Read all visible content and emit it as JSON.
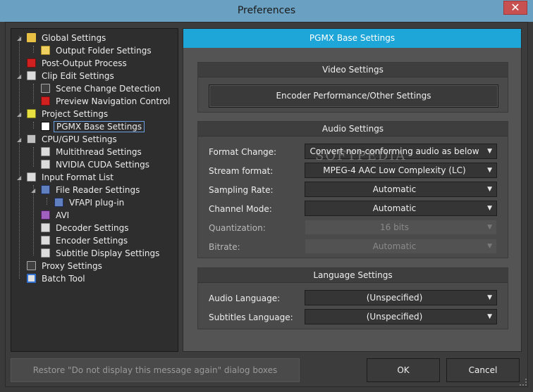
{
  "window": {
    "title": "Preferences",
    "close_glyph": "✕"
  },
  "tree": [
    {
      "label": "Global Settings",
      "icon": "folder-icon"
    },
    {
      "label": "Output Folder Settings",
      "icon": "folder-settings-icon"
    },
    {
      "label": "Post-Output Process",
      "icon": "process-icon"
    },
    {
      "label": "Clip Edit Settings",
      "icon": "document-icon"
    },
    {
      "label": "Scene Change Detection",
      "icon": "film-icon"
    },
    {
      "label": "Preview Navigation Control",
      "icon": "navigation-icon"
    },
    {
      "label": "Project Settings",
      "icon": "project-icon"
    },
    {
      "label": "PGMX Base Settings",
      "icon": "pgmx-icon"
    },
    {
      "label": "CPU/GPU Settings",
      "icon": "cpu-icon"
    },
    {
      "label": "Multithread Settings",
      "icon": "document-icon"
    },
    {
      "label": "NVIDIA CUDA Settings",
      "icon": "document-icon"
    },
    {
      "label": "Input Format List",
      "icon": "document-icon"
    },
    {
      "label": "File Reader Settings",
      "icon": "monitor-icon"
    },
    {
      "label": "VFAPI plug-in",
      "icon": "monitor-icon"
    },
    {
      "label": "AVI",
      "icon": "avi-icon"
    },
    {
      "label": "Decoder Settings",
      "icon": "document-icon"
    },
    {
      "label": "Encoder Settings",
      "icon": "document-icon"
    },
    {
      "label": "Subtitle Display Settings",
      "icon": "document-icon"
    },
    {
      "label": "Proxy Settings",
      "icon": "film-icon"
    },
    {
      "label": "Batch Tool",
      "icon": "clock-icon"
    }
  ],
  "panel": {
    "header": "PGMX Base Settings",
    "video": {
      "title": "Video Settings",
      "encoder_button": "Encoder Performance/Other Settings"
    },
    "audio": {
      "title": "Audio Settings",
      "rows": [
        {
          "label": "Format Change:",
          "value": "Convert non-conforming audio as below",
          "enabled": true
        },
        {
          "label": "Stream format:",
          "value": "MPEG-4 AAC Low Complexity (LC)",
          "enabled": true
        },
        {
          "label": "Sampling Rate:",
          "value": "Automatic",
          "enabled": true
        },
        {
          "label": "Channel Mode:",
          "value": "Automatic",
          "enabled": true
        },
        {
          "label": "Quantization:",
          "value": "16 bits",
          "enabled": false
        },
        {
          "label": "Bitrate:",
          "value": "Automatic",
          "enabled": false
        }
      ]
    },
    "language": {
      "title": "Language Settings",
      "rows": [
        {
          "label": "Audio Language:",
          "value": "(Unspecified)"
        },
        {
          "label": "Subtitles Language:",
          "value": "(Unspecified)"
        }
      ]
    },
    "watermark": "SOFTPEDIA"
  },
  "footer": {
    "restore_label": "Restore \"Do not display this message again\" dialog boxes",
    "ok_label": "OK",
    "cancel_label": "Cancel"
  },
  "glyphs": {
    "dropdown_arrow": "▼"
  }
}
